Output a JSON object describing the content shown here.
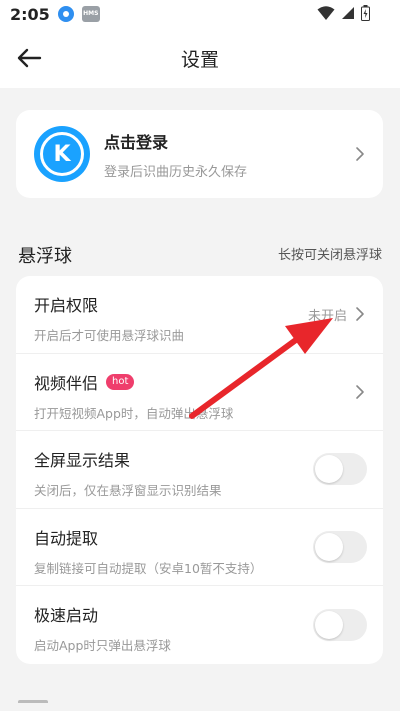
{
  "status_bar": {
    "time": "2:05",
    "badge": "HMS"
  },
  "header": {
    "title": "设置"
  },
  "login": {
    "avatar_letter": "K",
    "title": "点击登录",
    "subtitle": "登录后识曲历史永久保存"
  },
  "section": {
    "title": "悬浮球",
    "hint": "长按可关闭悬浮球"
  },
  "settings": {
    "rows": [
      {
        "title": "开启权限",
        "subtitle": "开启后才可使用悬浮球识曲",
        "status": "未开启"
      },
      {
        "title": "视频伴侣",
        "badge": "hot",
        "subtitle": "打开短视频App时，自动弹出悬浮球"
      },
      {
        "title": "全屏显示结果",
        "subtitle": "关闭后，仅在悬浮窗显示识别结果",
        "toggle_on": false
      },
      {
        "title": "自动提取",
        "subtitle": "复制链接可自动提取（安卓10暂不支持）",
        "toggle_on": false
      },
      {
        "title": "极速启动",
        "subtitle": "启动App时只弹出悬浮球",
        "toggle_on": false
      }
    ]
  },
  "colors": {
    "accent": "#1aa2ff",
    "hot_badge": "#ef3e6c",
    "annotation_arrow": "#e8262b"
  }
}
